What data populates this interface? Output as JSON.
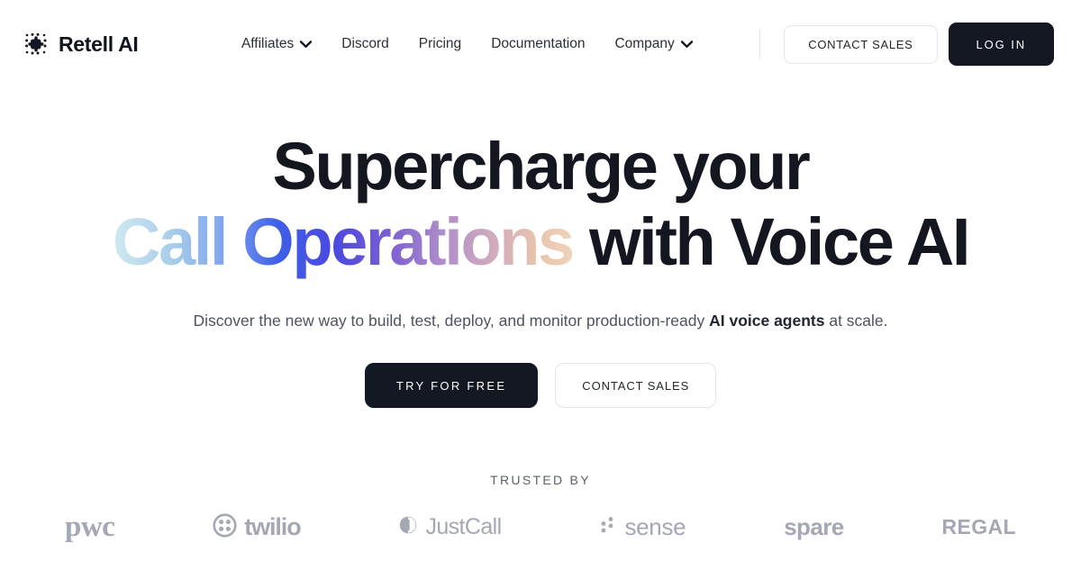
{
  "brand": {
    "name": "Retell AI",
    "logo_icon": "retell-dot-grid-icon"
  },
  "nav": {
    "items": [
      {
        "label": "Affiliates",
        "has_dropdown": true,
        "icon": "chevron-down-icon"
      },
      {
        "label": "Discord",
        "has_dropdown": false
      },
      {
        "label": "Pricing",
        "has_dropdown": false
      },
      {
        "label": "Documentation",
        "has_dropdown": false
      },
      {
        "label": "Company",
        "has_dropdown": true,
        "icon": "chevron-down-icon"
      }
    ]
  },
  "header_actions": {
    "contact_sales": "CONTACT SALES",
    "log_in": "LOG IN"
  },
  "hero": {
    "headline_line1": "Supercharge your",
    "headline_gradient": "Call Operations",
    "headline_line2_tail": "with Voice AI",
    "subhead_part1": "Discover the new way to build, test, deploy, and monitor production-ready ",
    "subhead_emphasis": "AI voice agents",
    "subhead_part2": " at scale.",
    "cta_primary": "TRY FOR FREE",
    "cta_secondary": "CONTACT SALES"
  },
  "trusted": {
    "label": "TRUSTED BY",
    "logos": [
      {
        "name": "pwc",
        "icon": null
      },
      {
        "name": "twilio",
        "icon": "twilio-circle-dots-icon"
      },
      {
        "name": "JustCall",
        "icon": "justcall-split-circle-icon"
      },
      {
        "name": "sense",
        "icon": "sense-four-dots-icon"
      },
      {
        "name": "spare",
        "icon": null
      },
      {
        "name": "REGAL",
        "icon": null
      }
    ]
  },
  "colors": {
    "text_dark": "#14171f",
    "text_muted": "#4e5361",
    "button_dark": "#141822",
    "border_light": "#e4e5e9",
    "logo_gray": "#a4a7b4",
    "gradient_start": "#cfe9ef",
    "gradient_mid": "#4a49e0",
    "gradient_end": "#f0d3bb"
  }
}
